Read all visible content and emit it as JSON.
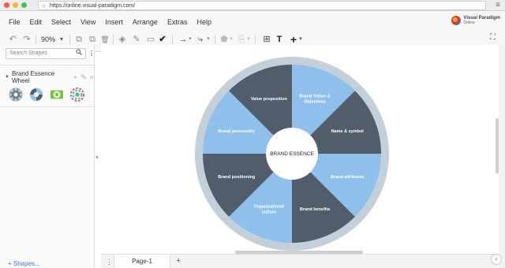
{
  "browser": {
    "url": "https://online.visual-paradigm.com/",
    "url_icon": "page-icon",
    "menu_icon": "≡"
  },
  "menu": [
    "File",
    "Edit",
    "Select",
    "View",
    "Insert",
    "Arrange",
    "Extras",
    "Help"
  ],
  "brand": {
    "name": "Visual Paradigm",
    "sub": "Online"
  },
  "toolbar": {
    "undo": "↶",
    "redo": "↷",
    "zoom": "90%",
    "zoom_caret": "▾",
    "to_front": "⧉",
    "to_back": "⧉",
    "delete": "🗑",
    "fill": "◈",
    "line_color": "✎",
    "shadow": "▭",
    "format_painter": "✔",
    "connector": "→",
    "connector_caret": "▾",
    "waypoint": "⤷",
    "waypoint_caret": "▾",
    "style1": "⬟",
    "style1_caret": "▾",
    "style2": "⎘",
    "style2_caret": "▾",
    "grid": "⊞",
    "text": "T",
    "insert": "+",
    "insert_caret": "▾",
    "fit": "⛶"
  },
  "sidebar": {
    "search_placeholder": "Search Shapes",
    "search_icon": "🔍",
    "kebab": "⋮",
    "panel_caret": "▼",
    "panel_title": "Brand Essence Wheel",
    "panel_add": "+",
    "panel_edit": "✎",
    "panel_close": "×",
    "more_shapes": "+ Shapes..."
  },
  "canvas": {
    "collapse_handle": "◂",
    "wheel": {
      "center": "BRAND ESSENCE",
      "segments": [
        {
          "lines": [
            "Brand Vision &",
            "Objectives"
          ],
          "color": "#8fc0ec"
        },
        {
          "lines": [
            "Name & symbol"
          ],
          "color": "#525d6c"
        },
        {
          "lines": [
            "Brand attributes"
          ],
          "color": "#8fc0ec"
        },
        {
          "lines": [
            "Brand benefits"
          ],
          "color": "#525d6c"
        },
        {
          "lines": [
            "Organizational",
            "culture"
          ],
          "color": "#8fc0ec"
        },
        {
          "lines": [
            "Brand positioning"
          ],
          "color": "#525d6c"
        },
        {
          "lines": [
            "Brand personality"
          ],
          "color": "#8fc0ec"
        },
        {
          "lines": [
            "Value proposition"
          ],
          "color": "#525d6c"
        }
      ],
      "ring_color": "#c3d0da"
    }
  },
  "pagebar": {
    "menu": "⋮",
    "page_tab": "Page-1",
    "add_page": "+"
  },
  "right_panel": {
    "collapse": "‹"
  }
}
